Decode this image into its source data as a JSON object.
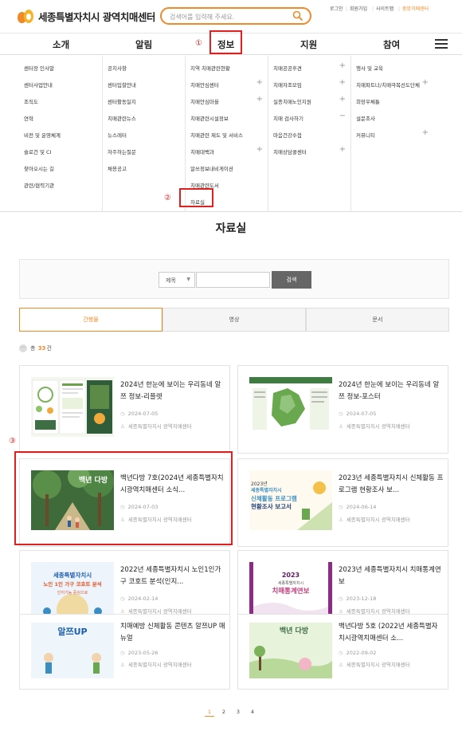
{
  "header": {
    "logo_text": "세종특별자치시 광역치매센터",
    "search_placeholder": "검색어를 입력해 주세요.",
    "util": [
      "로그인",
      "회원가입",
      "사이트맵",
      "중앙치매센터"
    ]
  },
  "gnb": {
    "items": [
      "소개",
      "알림",
      "정보",
      "지원",
      "참여"
    ],
    "active": "정보"
  },
  "steps": [
    "①",
    "②",
    "③"
  ],
  "mega_menu": {
    "col1": [
      "센터장 인사말",
      "센터사업안내",
      "조직도",
      "연혁",
      "비전 및 운영체계",
      "슬로건 및 CI",
      "찾아오시는 길",
      "관련/협력기관"
    ],
    "col2": [
      "공지사항",
      "센터입찰안내",
      "센터활동일지",
      "치매관련뉴스",
      "뉴스레터",
      "자주하는질문",
      "채용공고"
    ],
    "col3": [
      "지역 치매관련현황",
      "치매안심센터",
      "치매안심마을",
      "치매관련시설정보",
      "치매관련 제도 및 서비스",
      "치매대백과",
      "알쓰정보내비게이션",
      "치매관련도서",
      "자료실"
    ],
    "col4": [
      "치매공공후견",
      "치매자조모임",
      "실종치매노인지원",
      "치매 검사하기",
      "마음건강수첩",
      "치매상담콜센터"
    ],
    "col5": [
      "행사 및 교육",
      "치매파트너/치매극복선도단체",
      "희망우체통",
      "설문조사",
      "커뮤니티"
    ]
  },
  "page_title": "자료실",
  "search": {
    "select_value": "제목",
    "button": "검색"
  },
  "tabs": [
    "간행물",
    "영상",
    "문서"
  ],
  "total": {
    "prefix": "총",
    "count": "33",
    "suffix": "건"
  },
  "cards": [
    {
      "title": "2024년 한눈에 보이는 우리동네 알쯔 정보-리플렛",
      "date": "2024-07-05",
      "org": "세종특별자치시 광역치매센터"
    },
    {
      "title": "2024년 한눈에 보이는 우리동네 알쯔 정보-포스터",
      "date": "2024-07-05",
      "org": "세종특별자치시 광역치매센터"
    },
    {
      "title": "백년다방 7호(2024년 세종특별자치시광역치매센터 소식...",
      "date": "2024-07-03",
      "org": "세종특별자치시 광역치매센터",
      "thumb_text": "백년 다방"
    },
    {
      "title": "2023년 세종특별자치시 신체활동 프로그램 현황조사 보...",
      "date": "2024-06-14",
      "org": "세종특별자치시 광역치매센터",
      "thumb_lines": [
        "2023년",
        "세종특별자치시",
        "신체활동 프로그램",
        "현황조사 보고서"
      ]
    },
    {
      "title": "2022년 세종특별자치시 노인1인가구 코호트 분석(인지...",
      "date": "2024-02-14",
      "org": "세종특별자치시 광역치매센터",
      "thumb_lines": [
        "세종특별자치시",
        "노인 1인 가구 코호트 분석",
        "인지기능 중심으로"
      ]
    },
    {
      "title": "2023년 세종특별자치시 치매통계연보",
      "date": "2023-12-18",
      "org": "세종특별자치시 광역치매센터",
      "thumb_lines": [
        "2023",
        "세종특별자치시",
        "치매통계연보"
      ]
    },
    {
      "title": "치매예방 신체활동 콘텐츠 알쯔UP 매뉴얼",
      "date": "2023-05-26",
      "org": "세종특별자치시 광역치매센터",
      "thumb_text": "알쯔UP"
    },
    {
      "title": "백년다방 5호 (2022년 세종특별자치시광역치매센터 소...",
      "date": "2022-09-02",
      "org": "세종특별자치시 광역치매센터",
      "thumb_text": "백년 다방"
    }
  ],
  "pagination": [
    "1",
    "2",
    "3",
    "4"
  ],
  "colors": {
    "accent": "#f08a28",
    "highlight": "#e02020"
  }
}
